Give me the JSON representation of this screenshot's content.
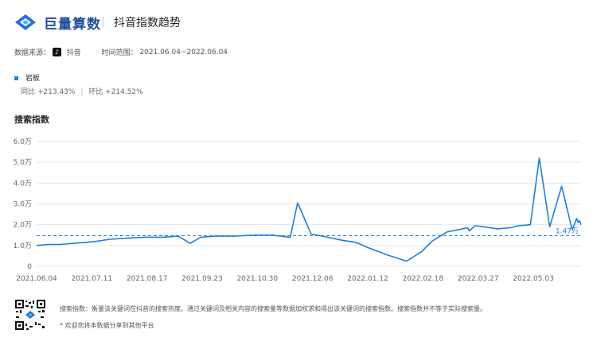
{
  "header": {
    "brand": "巨量算数",
    "page_title": "抖音指数趋势"
  },
  "meta": {
    "source_label": "数据来源：",
    "source_value": "抖音",
    "range_label": "时间范围：",
    "range_value": "2021.06.04~2022.06.04"
  },
  "legend": {
    "series_name": "岩板",
    "yoy": "同比 +213.43%",
    "divider": "|",
    "mom": "环比 +214.52%"
  },
  "section_title": "搜索指数",
  "colors": {
    "line": "#1e7fd8",
    "avg": "#1e7fd8",
    "grid": "#e6e6e6"
  },
  "chart_data": {
    "type": "line",
    "ylim": [
      0,
      6.0
    ],
    "y_ticks": [
      "0",
      "1.0万",
      "2.0万",
      "3.0万",
      "4.0万",
      "5.0万",
      "6.0万"
    ],
    "x_ticks": [
      "2021.06.04",
      "2021.07.11",
      "2021.08.17",
      "2021.09.23",
      "2021.10.30",
      "2021.12.06",
      "2022.01.12",
      "2022.02.18",
      "2022.03.27",
      "2022.05.03"
    ],
    "average": 1.47,
    "average_label": "1.47万",
    "series": [
      {
        "name": "岩板",
        "x": [
          0,
          8,
          16,
          24,
          33,
          40,
          49,
          60,
          72,
          84,
          95,
          103,
          110,
          120,
          133,
          145,
          158,
          170,
          175,
          184,
          195,
          205,
          214,
          222,
          235,
          248,
          258,
          265,
          275,
          282,
          289,
          290,
          294,
          300,
          309,
          317,
          323,
          331,
          337,
          344,
          352,
          359,
          362,
          363,
          364,
          365
        ],
        "values": [
          1.0,
          1.05,
          1.05,
          1.1,
          1.15,
          1.2,
          1.3,
          1.35,
          1.4,
          1.4,
          1.45,
          1.1,
          1.4,
          1.45,
          1.45,
          1.5,
          1.5,
          1.4,
          3.05,
          1.55,
          1.4,
          1.25,
          1.15,
          0.9,
          0.55,
          0.25,
          0.7,
          1.2,
          1.65,
          1.75,
          1.85,
          1.7,
          1.95,
          1.9,
          1.8,
          1.85,
          1.95,
          2.0,
          5.2,
          1.9,
          3.85,
          1.75,
          2.3,
          2.1,
          2.2,
          2.0
        ]
      }
    ]
  },
  "footer": {
    "note1": "搜索指数：衡量该关键词在抖音的搜索热度。通过关键词及相关内容的搜索量等数据加权求和得出该关键词的搜索指数。搜索指数并不等于实际搜索量。",
    "note2": "* 欢迎您将本数据分享到其他平台"
  }
}
